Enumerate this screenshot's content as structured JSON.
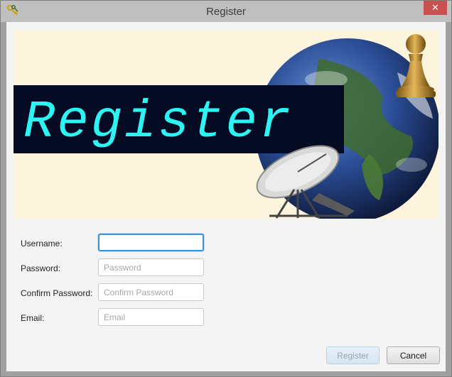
{
  "window": {
    "title": "Register",
    "close_glyph": "✕",
    "icon": "keys-icon"
  },
  "banner": {
    "text": "Register",
    "text_color": "#2ef3f3",
    "strip_color": "#050b22",
    "background_color": "#fcf4dc"
  },
  "form": {
    "username": {
      "label": "Username:",
      "value": "",
      "placeholder": ""
    },
    "password": {
      "label": "Password:",
      "value": "",
      "placeholder": "Password"
    },
    "confirm_password": {
      "label": "Confirm Password:",
      "value": "",
      "placeholder": "Confirm Password"
    },
    "email": {
      "label": "Email:",
      "value": "",
      "placeholder": "Email"
    }
  },
  "buttons": {
    "register_label": "Register",
    "register_enabled": false,
    "cancel_label": "Cancel"
  },
  "colors": {
    "focus_ring": "#3a93d6",
    "close_button": "#c75050"
  }
}
